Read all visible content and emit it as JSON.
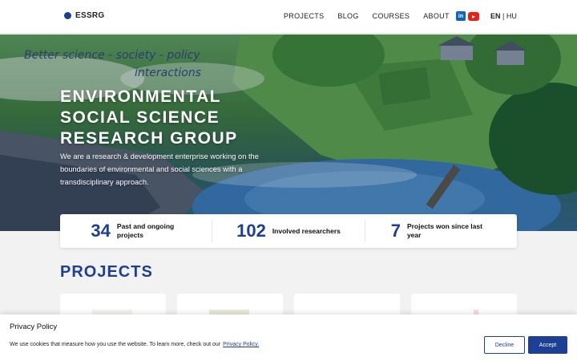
{
  "header": {
    "logo_text": "ESSRG",
    "nav": [
      "PROJECTS",
      "BLOG",
      "COURSES",
      "ABOUT"
    ],
    "social_icons": [
      "linkedin-icon",
      "youtube-icon"
    ],
    "lang_active": "EN",
    "lang_separator": "|",
    "lang_other": "HU"
  },
  "hero": {
    "handwriting_line1": "Better science - society - policy",
    "handwriting_line2": "interactions",
    "title_lines": [
      "ENVIRONMENTAL",
      "SOCIAL SCIENCE",
      "RESEARCH GROUP"
    ],
    "description": "We are a research & development enterprise working on the boundaries of environmental and social sciences with a transdisciplinary approach."
  },
  "stats": [
    {
      "number": "34",
      "label": "Past and ongoing projects"
    },
    {
      "number": "102",
      "label": "Involved researchers"
    },
    {
      "number": "7",
      "label": "Projects won since last year"
    }
  ],
  "projects": {
    "title": "PROJECTS"
  },
  "cookie": {
    "title": "Privacy Policy",
    "text": "We use cookies that measure how you use the website. To learn more, check out our",
    "link": "Privacy Policy.",
    "decline": "Decline",
    "accept": "Accept"
  },
  "colors": {
    "brand": "#1d3f94",
    "linkedin": "#0a66c2",
    "youtube": "#e62117"
  }
}
